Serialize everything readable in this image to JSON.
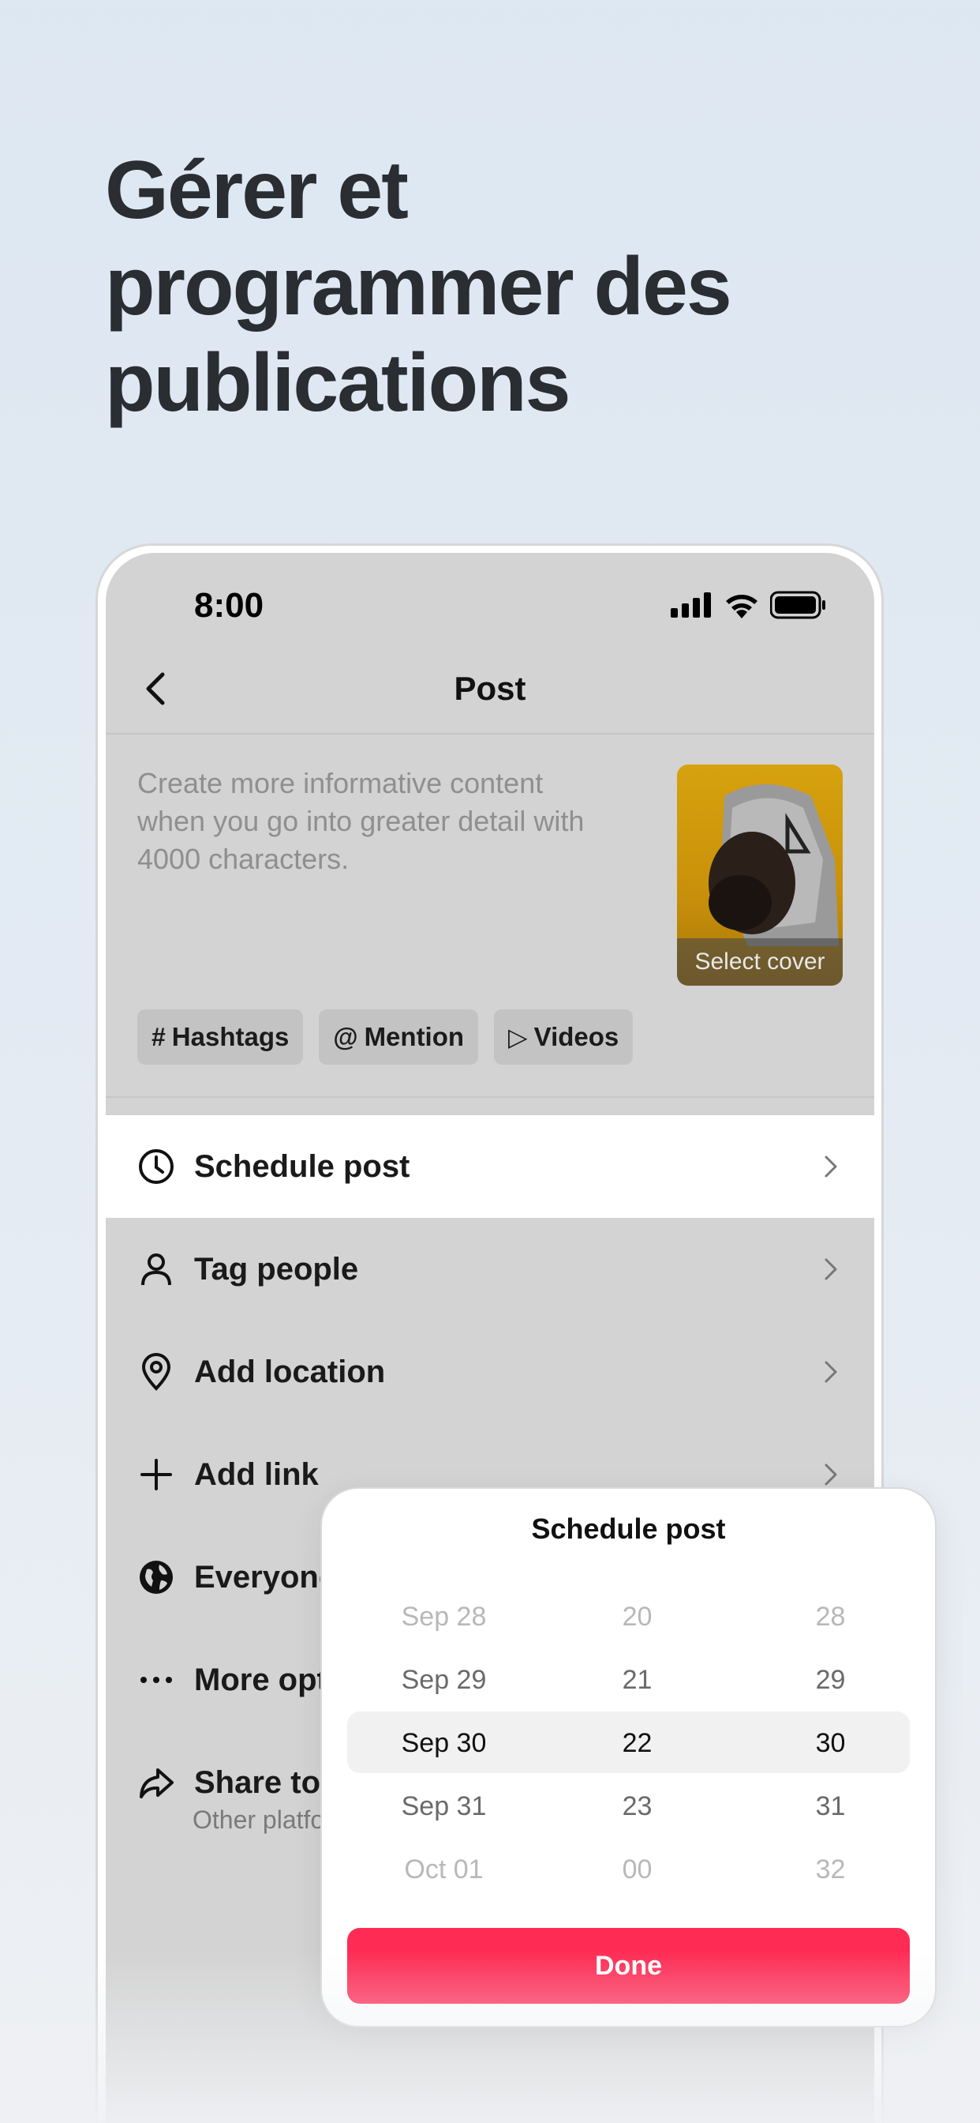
{
  "headline": [
    "Gérer et",
    "programmer des",
    "publications"
  ],
  "status": {
    "time": "8:00"
  },
  "nav": {
    "title": "Post"
  },
  "composer": {
    "placeholder": "Create more informative content when you go into greater detail with 4000 characters.",
    "cover_label": "Select cover"
  },
  "chips": [
    {
      "icon": "#",
      "label": "Hashtags"
    },
    {
      "icon": "@",
      "label": "Mention"
    },
    {
      "icon": "▷",
      "label": "Videos"
    }
  ],
  "menu": [
    {
      "label": "Schedule post",
      "icon": "clock-icon",
      "active": true
    },
    {
      "label": "Tag people",
      "icon": "person-icon"
    },
    {
      "label": "Add location",
      "icon": "location-pin-icon"
    },
    {
      "label": "Add link",
      "icon": "plus-icon"
    },
    {
      "label": "Everyone",
      "icon": "globe-icon"
    },
    {
      "label": "More options",
      "icon": "more-dots-icon"
    },
    {
      "label": "Share to",
      "icon": "share-icon",
      "sublabel": "Other platforms"
    }
  ],
  "schedule_sheet": {
    "title": "Schedule post",
    "dates": [
      "Sep 28",
      "Sep 29",
      "Sep 30",
      "Sep 31",
      "Oct 01"
    ],
    "hours": [
      "20",
      "21",
      "22",
      "23",
      "00"
    ],
    "minutes": [
      "28",
      "29",
      "30",
      "31",
      "32"
    ],
    "selected_index": 2,
    "done_label": "Done"
  },
  "colors": {
    "accent": "#fe2c55",
    "headline": "#2a2d31"
  }
}
